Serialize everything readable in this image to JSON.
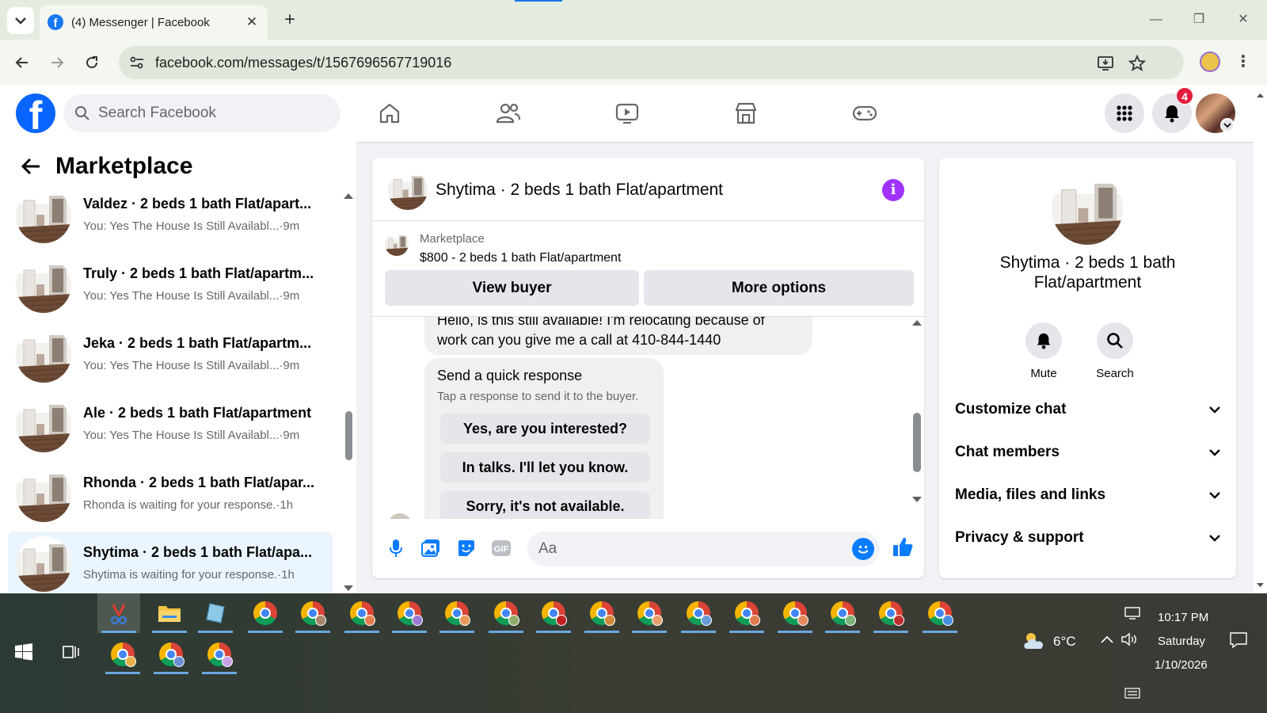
{
  "browser": {
    "tab_title": "(4) Messenger | Facebook",
    "url": "facebook.com/messages/t/1567696567719016"
  },
  "fb": {
    "search_placeholder": "Search Facebook",
    "notifications_count": "4"
  },
  "left": {
    "title": "Marketplace",
    "conversations": [
      {
        "name": "Valdez · 2 beds 1 bath Flat/apart...",
        "preview": "You: Yes The House Is Still Availabl...",
        "time": "·9m"
      },
      {
        "name": "Truly · 2 beds 1 bath Flat/apartm...",
        "preview": "You: Yes The House Is Still Availabl...",
        "time": "·9m"
      },
      {
        "name": "Jeka · 2 beds 1 bath Flat/apartm...",
        "preview": "You: Yes The House Is Still Availabl...",
        "time": "·9m"
      },
      {
        "name": "Ale · 2 beds 1 bath Flat/apartment",
        "preview": "You: Yes The House Is Still Availabl...",
        "time": "·9m"
      },
      {
        "name": "Rhonda · 2 beds 1 bath Flat/apar...",
        "preview": "Rhonda is waiting for your response.",
        "time": "·1h"
      },
      {
        "name": "Shytima · 2 beds 1 bath Flat/apa...",
        "preview": "Shytima is waiting for your response.",
        "time": "·1h"
      }
    ]
  },
  "chat": {
    "title": "Shytima · 2 beds 1 bath Flat/apartment",
    "listing_label": "Marketplace",
    "listing_price": "$800 - 2 beds 1 bath Flat/apartment",
    "view_buyer": "View buyer",
    "more_options": "More options",
    "message_line1": "Hello, is this still available! I'm relocating because of",
    "message_line2": "work can you give me a call at 410-844-1440",
    "quick_title": "Send a quick response",
    "quick_sub": "Tap a response to send it to the buyer.",
    "quick_options": [
      "Yes, are you interested?",
      "In talks. I'll let you know.",
      "Sorry, it's not available."
    ],
    "composer_placeholder": "Aa"
  },
  "right": {
    "title": "Shytima · 2 beds 1 bath Flat/apartment",
    "mute": "Mute",
    "search": "Search",
    "sections": [
      "Customize chat",
      "Chat members",
      "Media, files and links",
      "Privacy & support"
    ]
  },
  "taskbar": {
    "temperature": "6°C",
    "time": "10:17 PM",
    "day": "Saturday",
    "date": "1/10/2026"
  },
  "colors": {
    "fb_blue": "#0866ff",
    "messenger_blue": "#0a7cff",
    "info_purple": "#a033ff",
    "badge_red": "#e41e3f"
  }
}
